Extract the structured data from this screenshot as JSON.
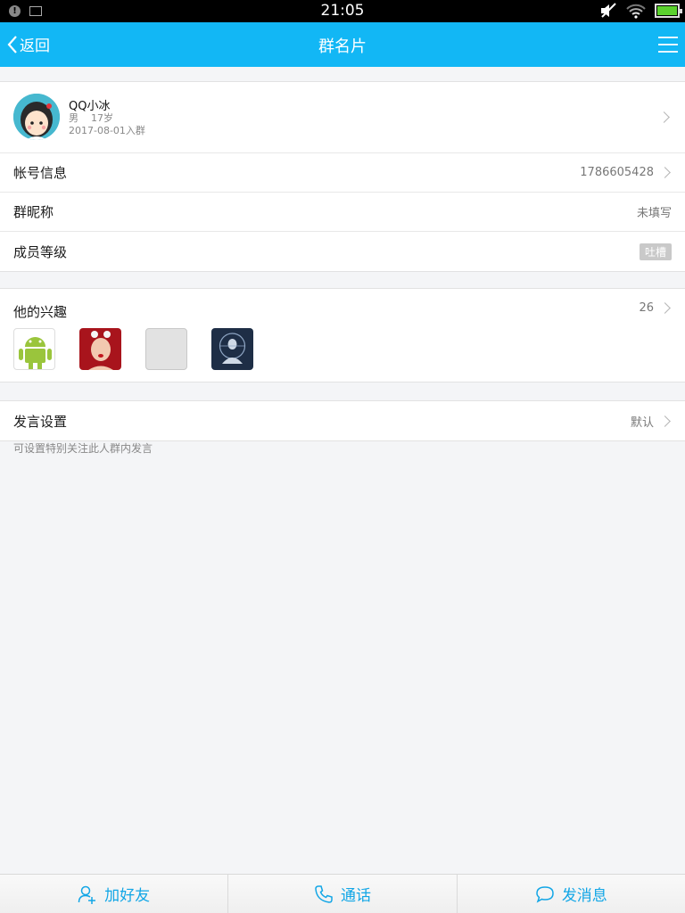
{
  "statusbar": {
    "time": "21:05"
  },
  "header": {
    "back_label": "返回",
    "title": "群名片"
  },
  "profile": {
    "name": "QQ小冰",
    "gender": "男",
    "age": "17岁",
    "join_date": "2017-08-01入群"
  },
  "rows": {
    "account": {
      "label": "帐号信息",
      "value": "1786605428"
    },
    "nickname": {
      "label": "群昵称",
      "value": "未填写"
    },
    "level": {
      "label": "成员等级",
      "value": "吐槽"
    }
  },
  "interests": {
    "label": "他的兴趣",
    "count": "26"
  },
  "speak": {
    "label": "发言设置",
    "value": "默认"
  },
  "hint": "可设置特别关注此人群内发言",
  "bottom": {
    "add_friend": "加好友",
    "call": "通话",
    "message": "发消息"
  },
  "colors": {
    "accent": "#12b7f5",
    "battery": "#5bd22e"
  }
}
